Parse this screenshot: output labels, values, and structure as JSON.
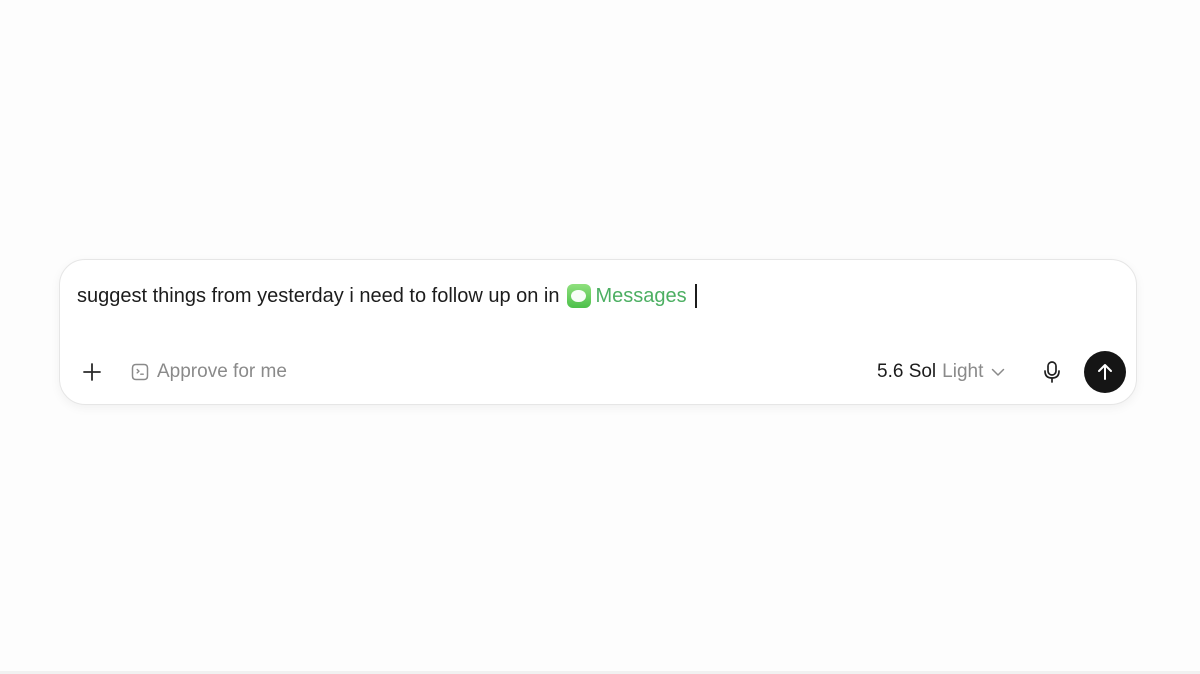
{
  "composer": {
    "prompt_text": "suggest things from yesterday i need to follow up on in",
    "app_mention": {
      "label": "Messages",
      "icon": "messages-app-icon",
      "color": "#4caf62"
    },
    "toolbar": {
      "add_icon": "plus-icon",
      "approve_label": "Approve for me",
      "approve_icon": "approve-face-icon",
      "model_name": "5.6 Sol",
      "model_mode": "Light",
      "model_chevron_icon": "chevron-down-icon",
      "mic_icon": "microphone-icon",
      "send_icon": "arrow-up-icon"
    }
  },
  "colors": {
    "background": "#fdfdfd",
    "text": "#1c1c1c",
    "muted": "#8a8a8a",
    "send_button": "#151515"
  }
}
